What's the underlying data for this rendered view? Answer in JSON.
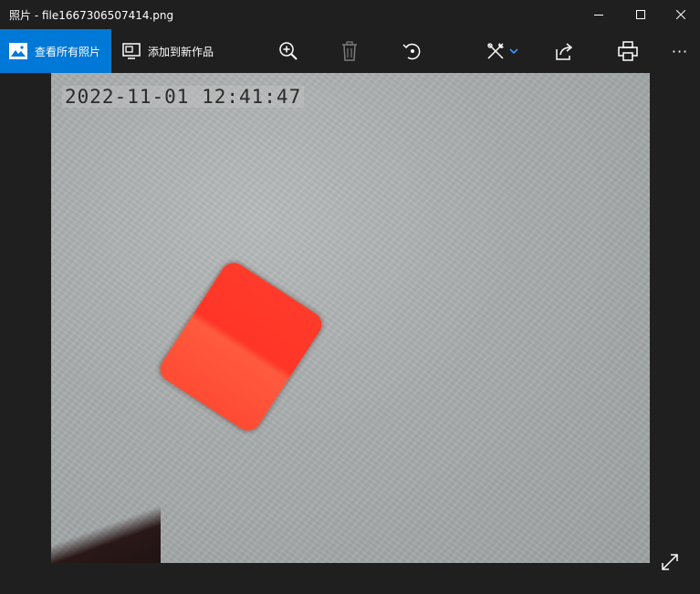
{
  "window": {
    "title": "照片 - file1667306507414.png"
  },
  "toolbar": {
    "all_photos_label": "查看所有照片",
    "add_to_creation_label": "添加到新作品",
    "tools": [
      "zoom-in-icon",
      "delete-icon",
      "rotate-icon",
      "edit-icon",
      "share-icon",
      "print-icon",
      "more-icon"
    ],
    "more_label": "···"
  },
  "photo": {
    "timestamp": "2022-11-01 12:41:47"
  },
  "colors": {
    "accent": "#0078d7",
    "background": "#1f1f1f",
    "object": "#ff3b2a"
  }
}
